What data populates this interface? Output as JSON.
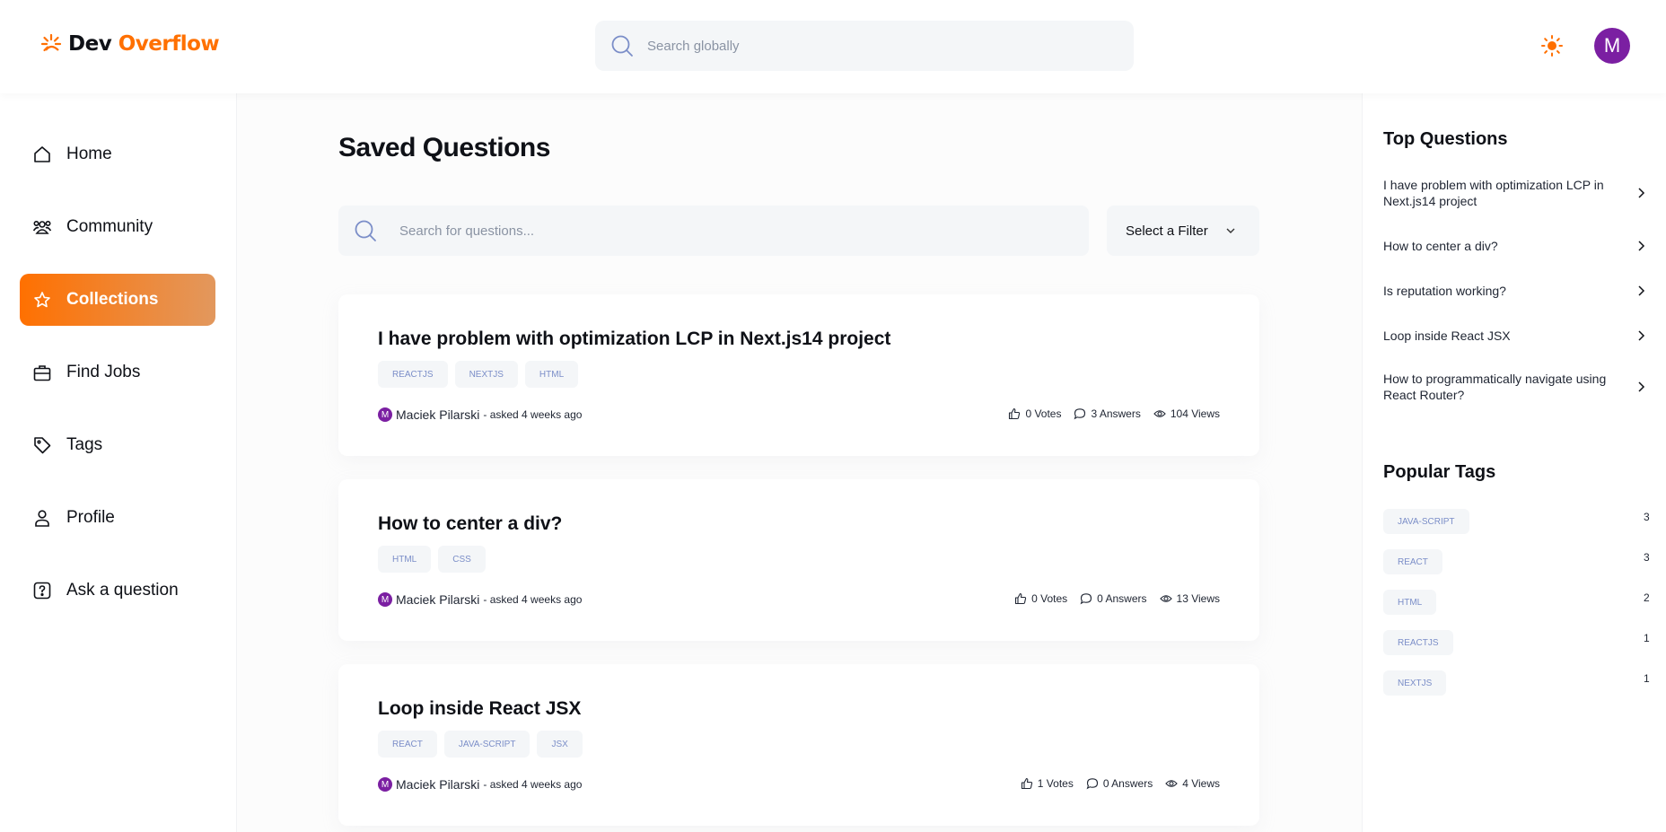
{
  "header": {
    "logo_part1": "Dev ",
    "logo_part2": "Overflow",
    "search_placeholder": "Search globally",
    "avatar_initial": "M",
    "brand_color": "#ff7000",
    "avatar_color": "#7b1fa2"
  },
  "sidebar": {
    "items": [
      {
        "label": "Home",
        "icon": "home-icon"
      },
      {
        "label": "Community",
        "icon": "users-icon"
      },
      {
        "label": "Collections",
        "icon": "star-icon",
        "active": true
      },
      {
        "label": "Find Jobs",
        "icon": "briefcase-icon"
      },
      {
        "label": "Tags",
        "icon": "tag-icon"
      },
      {
        "label": "Profile",
        "icon": "user-icon"
      },
      {
        "label": "Ask a question",
        "icon": "question-icon"
      }
    ]
  },
  "main": {
    "title": "Saved Questions",
    "search_placeholder": "Search for questions...",
    "filter_label": "Select a Filter",
    "questions": [
      {
        "title": "I have problem with optimization LCP in Next.js14 project",
        "tags": [
          "REACTJS",
          "NEXTJS",
          "HTML"
        ],
        "author": "Maciek Pilarski",
        "author_initial": "M",
        "asked": "- asked 4 weeks ago",
        "votes": "0 Votes",
        "answers": "3 Answers",
        "views": "104 Views"
      },
      {
        "title": "How to center a div?",
        "tags": [
          "HTML",
          "CSS"
        ],
        "author": "Maciek Pilarski",
        "author_initial": "M",
        "asked": "- asked 4 weeks ago",
        "votes": "0 Votes",
        "answers": "0 Answers",
        "views": "13 Views"
      },
      {
        "title": "Loop inside React JSX",
        "tags": [
          "REACT",
          "JAVA-SCRIPT",
          "JSX"
        ],
        "author": "Maciek Pilarski",
        "author_initial": "M",
        "asked": "- asked 4 weeks ago",
        "votes": "1 Votes",
        "answers": "0 Answers",
        "views": "4 Views"
      }
    ]
  },
  "right_sidebar": {
    "top_questions_heading": "Top Questions",
    "top_questions": [
      "I have problem with optimization LCP in Next.js14 project",
      "How to center a div?",
      "Is reputation working?",
      "Loop inside React JSX",
      "How to programmatically navigate using React Router?"
    ],
    "popular_tags_heading": "Popular Tags",
    "popular_tags": [
      {
        "name": "JAVA-SCRIPT",
        "count": "3"
      },
      {
        "name": "REACT",
        "count": "3"
      },
      {
        "name": "HTML",
        "count": "2"
      },
      {
        "name": "REACTJS",
        "count": "1"
      },
      {
        "name": "NEXTJS",
        "count": "1"
      }
    ]
  }
}
